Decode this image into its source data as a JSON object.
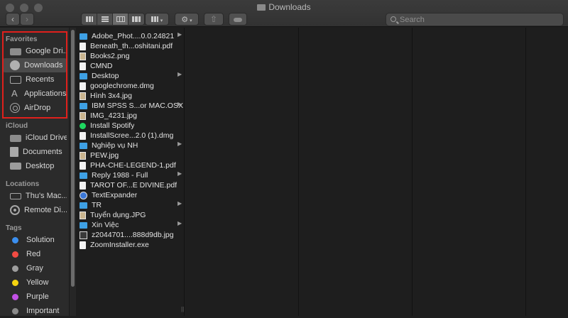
{
  "window": {
    "title": "Downloads"
  },
  "toolbar": {
    "back_icon": "chevron-left-icon",
    "forward_icon": "chevron-right-icon",
    "search_placeholder": "Search"
  },
  "sidebar": {
    "favorites_label": "Favorites",
    "favorites": [
      {
        "label": "Google Dri...",
        "icon": "folder-icon"
      },
      {
        "label": "Downloads",
        "icon": "download-icon"
      },
      {
        "label": "Recents",
        "icon": "clock-icon"
      },
      {
        "label": "Applications",
        "icon": "applications-icon"
      },
      {
        "label": "AirDrop",
        "icon": "airdrop-icon"
      }
    ],
    "icloud_label": "iCloud",
    "icloud": [
      {
        "label": "iCloud Drive",
        "icon": "cloud-icon"
      },
      {
        "label": "Documents",
        "icon": "document-icon"
      },
      {
        "label": "Desktop",
        "icon": "desktop-icon"
      }
    ],
    "locations_label": "Locations",
    "locations": [
      {
        "label": "Thu's Mac...",
        "icon": "laptop-icon"
      },
      {
        "label": "Remote Di...",
        "icon": "disc-icon"
      }
    ],
    "tags_label": "Tags",
    "tags": [
      {
        "label": "Solution",
        "color": "#3b8ff0"
      },
      {
        "label": "Red",
        "color": "#f24b43"
      },
      {
        "label": "Gray",
        "color": "#9e9e9e"
      },
      {
        "label": "Yellow",
        "color": "#f5d30f"
      },
      {
        "label": "Purple",
        "color": "#c251e6"
      },
      {
        "label": "Important",
        "color": "#8a8a8a"
      }
    ]
  },
  "files": [
    {
      "name": "Adobe_Phot....0.0.24821",
      "kind": "folder",
      "chevron": true
    },
    {
      "name": "Beneath_th...oshitani.pdf",
      "kind": "doc"
    },
    {
      "name": "Books2.png",
      "kind": "img"
    },
    {
      "name": "CMND",
      "kind": "doc"
    },
    {
      "name": "Desktop",
      "kind": "folder",
      "chevron": true
    },
    {
      "name": "googlechrome.dmg",
      "kind": "doc"
    },
    {
      "name": "Hình 3x4.jpg",
      "kind": "img"
    },
    {
      "name": "IBM SPSS S...or MAC.OSX",
      "kind": "folder",
      "chevron": true
    },
    {
      "name": "IMG_4231.jpg",
      "kind": "img"
    },
    {
      "name": "Install Spotify",
      "kind": "green"
    },
    {
      "name": "InstallScree...2.0 (1).dmg",
      "kind": "doc"
    },
    {
      "name": "Nghiệp vụ NH",
      "kind": "folder",
      "chevron": true
    },
    {
      "name": "PEW.jpg",
      "kind": "img"
    },
    {
      "name": "PHA-CHE-LEGEND-1.pdf",
      "kind": "doc"
    },
    {
      "name": "Reply 1988 - Full",
      "kind": "folder",
      "chevron": true
    },
    {
      "name": "TAROT OF...E DIVINE.pdf",
      "kind": "doc"
    },
    {
      "name": "TextExpander",
      "kind": "blue"
    },
    {
      "name": "TR",
      "kind": "folder",
      "chevron": true
    },
    {
      "name": "Tuyển dụng.JPG",
      "kind": "img"
    },
    {
      "name": "Xin Việc",
      "kind": "folder",
      "chevron": true
    },
    {
      "name": "z2044701....888d9db.jpg",
      "kind": "dark"
    },
    {
      "name": "ZoomInstaller.exe",
      "kind": "doc"
    }
  ]
}
